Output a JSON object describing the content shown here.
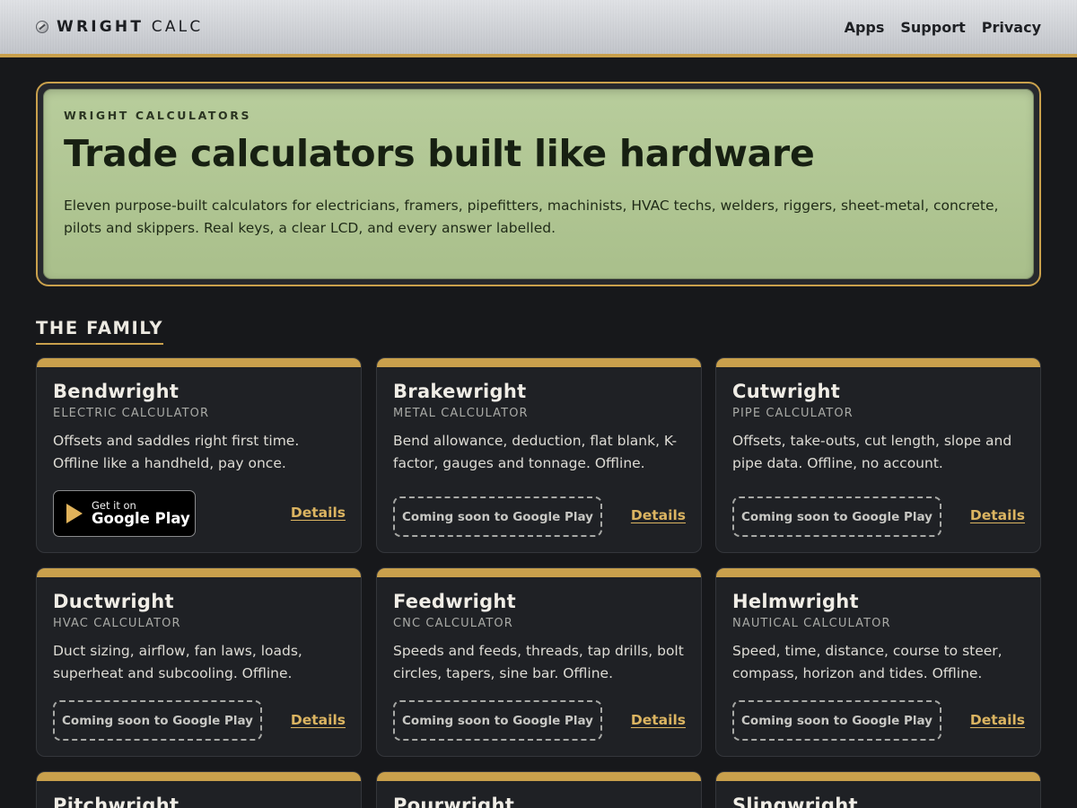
{
  "header": {
    "brand_bold": "WRIGHT",
    "brand_light": "CALC",
    "nav": [
      "Apps",
      "Support",
      "Privacy"
    ]
  },
  "hero": {
    "kicker": "WRIGHT CALCULATORS",
    "title": "Trade calculators built like hardware",
    "description": "Eleven purpose-built calculators for electricians, framers, pipefitters, machinists, HVAC techs, welders, riggers, sheet-metal, concrete, pilots and skippers. Real keys, a clear LCD, and every answer labelled."
  },
  "section": {
    "title": "THE FAMILY"
  },
  "cards": [
    {
      "name": "Bendwright",
      "subtitle": "ELECTRIC CALCULATOR",
      "description": "Offsets and saddles right first time. Offline like a handheld, pay once.",
      "store": {
        "small": "Get it on",
        "big": "Google Play"
      },
      "details": "Details"
    },
    {
      "name": "Brakewright",
      "subtitle": "METAL CALCULATOR",
      "description": "Bend allowance, deduction, flat blank, K-factor, gauges and tonnage. Offline.",
      "soon": "Coming soon to Google Play",
      "details": "Details"
    },
    {
      "name": "Cutwright",
      "subtitle": "PIPE CALCULATOR",
      "description": "Offsets, take-outs, cut length, slope and pipe data. Offline, no account.",
      "soon": "Coming soon to Google Play",
      "details": "Details"
    },
    {
      "name": "Ductwright",
      "subtitle": "HVAC CALCULATOR",
      "description": "Duct sizing, airflow, fan laws, loads, superheat and subcooling. Offline.",
      "soon": "Coming soon to Google Play",
      "details": "Details"
    },
    {
      "name": "Feedwright",
      "subtitle": "CNC CALCULATOR",
      "description": "Speeds and feeds, threads, tap drills, bolt circles, tapers, sine bar. Offline.",
      "soon": "Coming soon to Google Play",
      "details": "Details"
    },
    {
      "name": "Helmwright",
      "subtitle": "NAUTICAL CALCULATOR",
      "description": "Speed, time, distance, course to steer, compass, horizon and tides. Offline.",
      "soon": "Coming soon to Google Play",
      "details": "Details"
    },
    {
      "name": "Pitchwright"
    },
    {
      "name": "Pourwright"
    },
    {
      "name": "Slingwright"
    }
  ],
  "colors": {
    "accent": "#c9a04c",
    "background": "#17181b",
    "card": "#1f2125",
    "lcd": "#b8cd9c",
    "link": "#dbb461"
  },
  "icons": {
    "brand": "screw-head-icon",
    "store": "play-triangle-icon"
  }
}
